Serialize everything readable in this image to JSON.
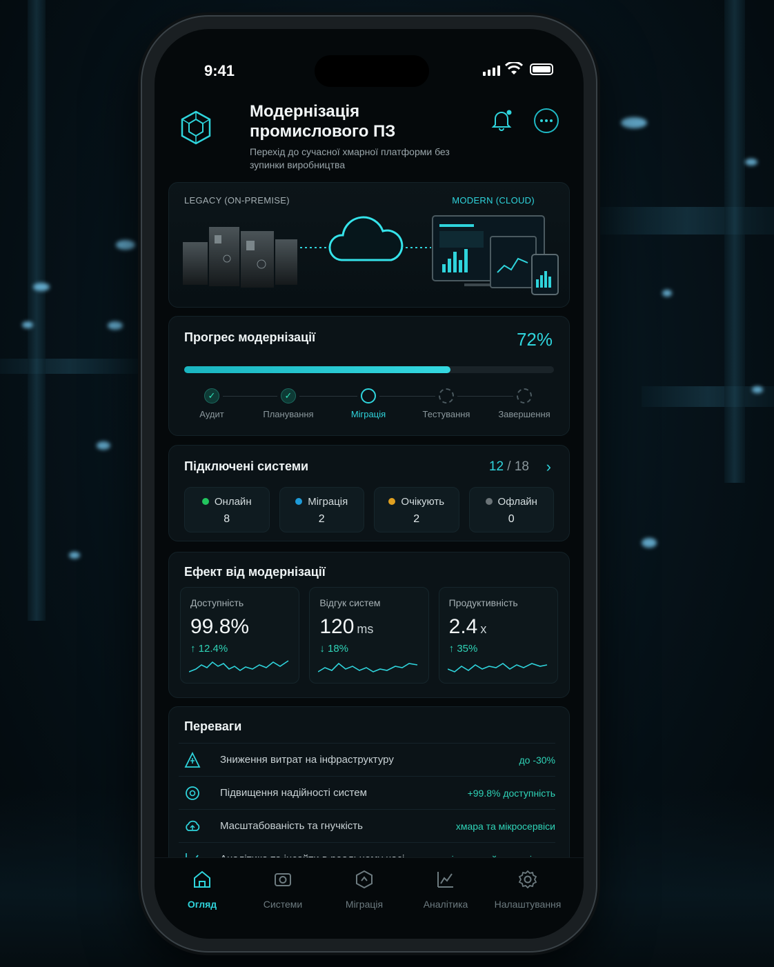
{
  "status_bar": {
    "time": "9:41"
  },
  "header": {
    "title": "Модернізація промислового ПЗ",
    "subtitle": "Перехід до сучасної хмарної платформи без зупинки виробництва",
    "icons": {
      "logo": "cube-icon",
      "bell": "bell-icon",
      "more": "more-icon"
    }
  },
  "hero": {
    "legacy_label": "LEGACY (ON-PREMISE)",
    "modern_label": "MODERN (CLOUD)"
  },
  "progress": {
    "title": "Прогрес модернізації",
    "percent_label": "72%",
    "percent_value": 72,
    "steps": [
      {
        "label": "Аудит",
        "state": "done"
      },
      {
        "label": "Планування",
        "state": "done"
      },
      {
        "label": "Міграція",
        "state": "active"
      },
      {
        "label": "Тестування",
        "state": "todo"
      },
      {
        "label": "Завершення",
        "state": "todo"
      }
    ]
  },
  "systems": {
    "title": "Підключені системи",
    "connected": "12",
    "total": "18",
    "statuses": [
      {
        "label": "Онлайн",
        "count": "8",
        "color": "#22c55e"
      },
      {
        "label": "Міграція",
        "count": "2",
        "color": "#1e9bd8"
      },
      {
        "label": "Очікують",
        "count": "2",
        "color": "#e0a020"
      },
      {
        "label": "Офлайн",
        "count": "0",
        "color": "#6b7478"
      }
    ]
  },
  "effect": {
    "title": "Ефект від модернізації",
    "metrics": [
      {
        "title": "Доступність",
        "value": "99.8%",
        "unit": "",
        "delta": "↑ 12.4%"
      },
      {
        "title": "Відгук систем",
        "value": "120",
        "unit": "ms",
        "delta": "↓ 18%"
      },
      {
        "title": "Продуктивність",
        "value": "2.4",
        "unit": "x",
        "delta": "↑ 35%"
      }
    ]
  },
  "benefits": {
    "title": "Переваги",
    "items": [
      {
        "icon": "cost-icon",
        "text": "Зниження витрат на інфраструктуру",
        "value": "до -30%"
      },
      {
        "icon": "reliability-icon",
        "text": "Підвищення надійності систем",
        "value": "+99.8% доступність"
      },
      {
        "icon": "cloud-scale-icon",
        "text": "Масштабованість та гнучкість",
        "value": "хмара та мікросервіси"
      },
      {
        "icon": "analytics-icon",
        "text": "Аналітика та інсайти в реальному часі",
        "value": "дані для прийняття рішень"
      }
    ]
  },
  "tabbar": {
    "tabs": [
      {
        "label": "Огляд",
        "icon": "home-icon",
        "active": true
      },
      {
        "label": "Системи",
        "icon": "systems-icon",
        "active": false
      },
      {
        "label": "Міграція",
        "icon": "migration-icon",
        "active": false
      },
      {
        "label": "Аналітика",
        "icon": "analytics-icon",
        "active": false
      },
      {
        "label": "Налаштування",
        "icon": "settings-icon",
        "active": false
      }
    ]
  },
  "colors": {
    "accent": "#2fd4dc",
    "positive": "#2fd4b8",
    "background": "#05090b"
  }
}
